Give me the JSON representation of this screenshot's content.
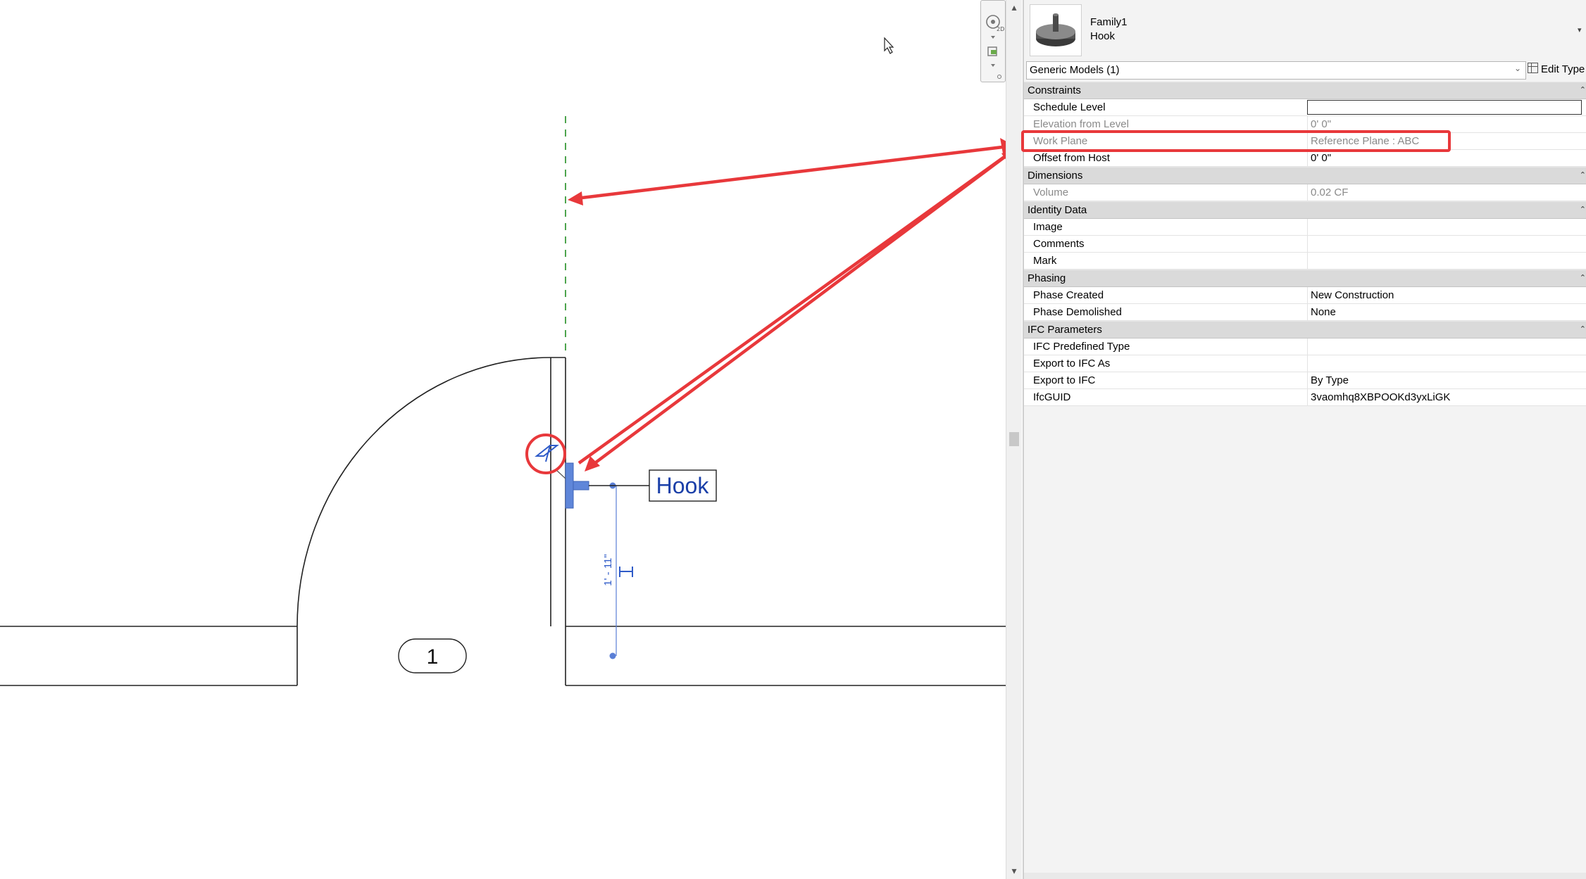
{
  "properties": {
    "family_name": "Family1",
    "type_name": "Hook",
    "selector_label": "Generic Models (1)",
    "edit_type_label": "Edit Type",
    "groups": [
      {
        "name": "Constraints",
        "rows": [
          {
            "name": "Schedule Level",
            "value": ""
          },
          {
            "name": "Elevation from Level",
            "value": "0'  0\""
          },
          {
            "name": "Work Plane",
            "value": "Reference Plane : ABC"
          },
          {
            "name": "Offset from Host",
            "value": "0'  0\""
          }
        ]
      },
      {
        "name": "Dimensions",
        "rows": [
          {
            "name": "Volume",
            "value": "0.02 CF"
          }
        ]
      },
      {
        "name": "Identity Data",
        "rows": [
          {
            "name": "Image",
            "value": ""
          },
          {
            "name": "Comments",
            "value": ""
          },
          {
            "name": "Mark",
            "value": ""
          }
        ]
      },
      {
        "name": "Phasing",
        "rows": [
          {
            "name": "Phase Created",
            "value": "New Construction"
          },
          {
            "name": "Phase Demolished",
            "value": "None"
          }
        ]
      },
      {
        "name": "IFC Parameters",
        "rows": [
          {
            "name": "IFC Predefined Type",
            "value": ""
          },
          {
            "name": "Export to IFC As",
            "value": ""
          },
          {
            "name": "Export to IFC",
            "value": "By Type"
          },
          {
            "name": "IfcGUID",
            "value": "3vaomhq8XBPOOKd3yxLiGK"
          }
        ]
      }
    ]
  },
  "drawing": {
    "tag_label": "Hook",
    "room_number": "1",
    "dimension_text": "1' - 11\""
  },
  "colors": {
    "annotation_red": "#e8383b",
    "reference_plane_green": "#3a9a3a",
    "selection_blue": "#4a72c6",
    "tag_text_blue": "#1a3fa8"
  }
}
